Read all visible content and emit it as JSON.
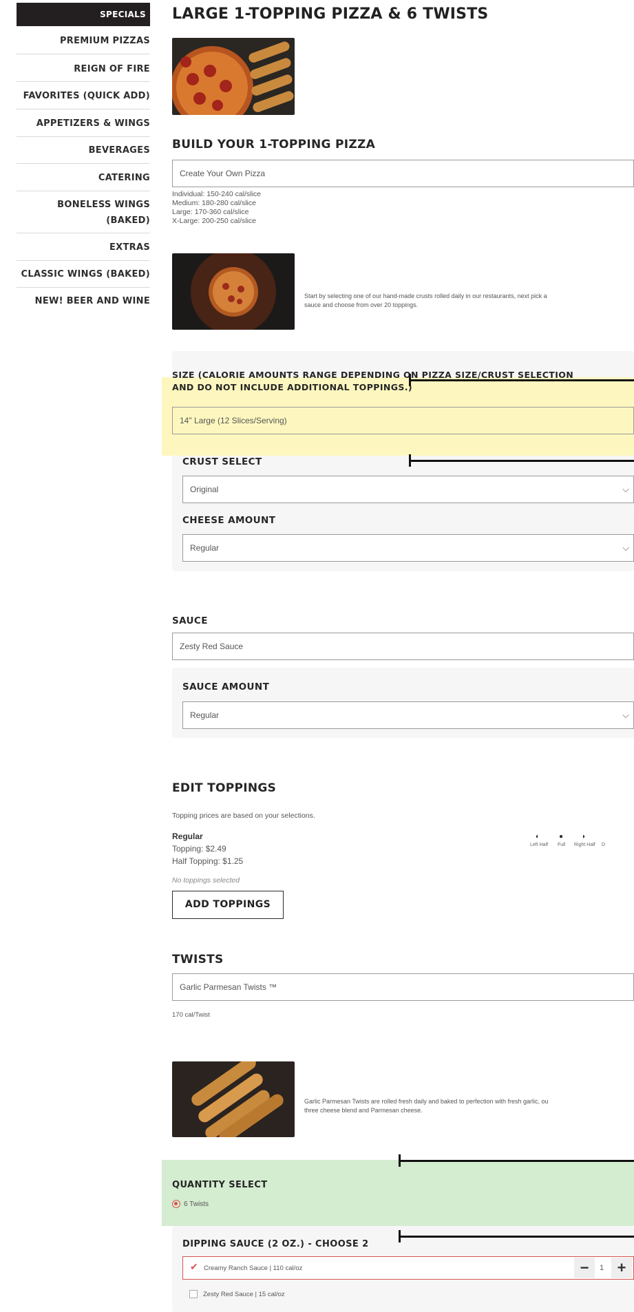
{
  "sidebar": {
    "items": [
      {
        "label": "SPECIALS",
        "active": true
      },
      {
        "label": "PREMIUM PIZZAS"
      },
      {
        "label": "REIGN OF FIRE"
      },
      {
        "label": "FAVORITES (QUICK ADD)"
      },
      {
        "label": "APPETIZERS & WINGS"
      },
      {
        "label": "BEVERAGES"
      },
      {
        "label": "CATERING"
      },
      {
        "label": "BONELESS WINGS"
      },
      {
        "label": "(BAKED)"
      },
      {
        "label": "EXTRAS"
      },
      {
        "label": "CLASSIC WINGS (BAKED)"
      },
      {
        "label": "NEW! BEER AND WINE"
      }
    ]
  },
  "product": {
    "title": "LARGE 1-TOPPING PIZZA & 6 TWISTS"
  },
  "build": {
    "heading": "BUILD YOUR 1-TOPPING PIZZA",
    "select_value": "Create Your Own Pizza",
    "calories": [
      "Individual: 150-240 cal/slice",
      "Medium: 180-280 cal/slice",
      "Large: 170-360 cal/slice",
      "X-Large: 200-250 cal/slice"
    ],
    "description_line1": "Start by selecting one of our hand-made crusts rolled daily in our restaurants, next pick a",
    "description_line2": "sauce and choose from over 20 toppings."
  },
  "size": {
    "heading_line1": "SIZE (CALORIE AMOUNTS RANGE DEPENDING ON PIZZA SIZE/CRUST SELECTION",
    "heading_line2": "AND DO NOT INCLUDE ADDITIONAL TOPPINGS.)",
    "value": "14\" Large (12 Slices/Serving)"
  },
  "crust": {
    "heading": "CRUST SELECT",
    "value": "Original"
  },
  "cheese": {
    "heading": "CHEESE AMOUNT",
    "value": "Regular"
  },
  "sauce": {
    "heading": "SAUCE",
    "value": "Zesty Red Sauce",
    "amount_heading": "SAUCE AMOUNT",
    "amount_value": "Regular"
  },
  "toppings": {
    "heading": "EDIT TOPPINGS",
    "note": "Topping prices are based on your selections.",
    "tier": "Regular",
    "topping_price": "Topping: $2.49",
    "half_price": "Half Topping: $1.25",
    "empty": "No toppings selected",
    "placements": [
      "Left Half",
      "Full",
      "Right Half",
      "D"
    ],
    "add_button": "ADD TOPPINGS"
  },
  "twists": {
    "heading": "TWISTS",
    "value": "Garlic Parmesan Twists ™",
    "calories": "170 cal/Twist",
    "description_line1": "Garlic Parmesan Twists are rolled fresh daily and baked to perfection with fresh garlic, ou",
    "description_line2": "three cheese blend and Parmesan cheese."
  },
  "quantity": {
    "heading": "QUANTITY SELECT",
    "value": "6 Twists"
  },
  "dipping": {
    "heading": "DIPPING SAUCE (2 OZ.) - CHOOSE 2",
    "options": [
      {
        "label": "Creamy Ranch Sauce | 110 cal/oz",
        "checked": true,
        "qty": "1"
      },
      {
        "label": "Zesty Red Sauce | 15 cal/oz",
        "checked": false
      }
    ]
  },
  "icons": {
    "chevron": "chevron-down-icon",
    "checkmark": "checkmark-icon",
    "radio": "radio-selected-icon",
    "minus": "minus-icon",
    "plus": "plus-icon"
  },
  "colors": {
    "active_bg": "#231f20",
    "highlight_yellow": "#fdf7bf",
    "highlight_green": "#d4ecd0",
    "selected_border": "#d9534f"
  }
}
